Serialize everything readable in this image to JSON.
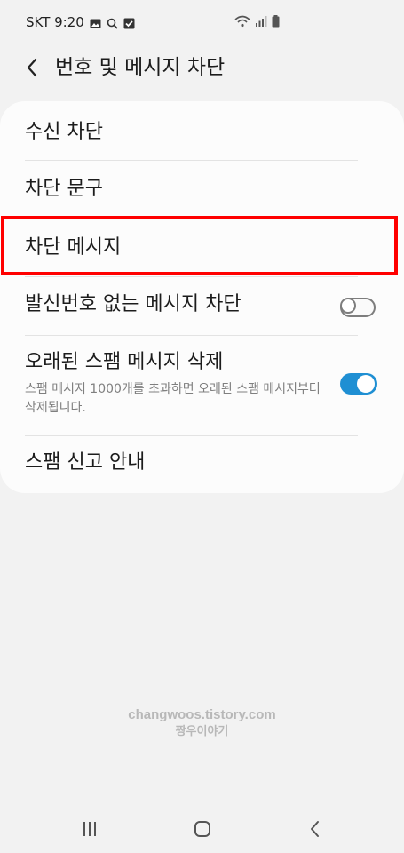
{
  "status_bar": {
    "time": "SKT 9:20",
    "icons": [
      "gallery-icon",
      "search-icon",
      "check-icon",
      "wifi-icon",
      "signal-icon",
      "battery-icon"
    ]
  },
  "header": {
    "title": "번호 및 메시지 차단",
    "back_icon": "chevron-left-icon"
  },
  "settings": {
    "items": [
      {
        "label": "수신 차단"
      },
      {
        "label": "차단 문구"
      },
      {
        "label": "차단 메시지"
      },
      {
        "label": "발신번호 없는 메시지 차단",
        "toggle": false
      },
      {
        "label": "오래된 스팸 메시지 삭제",
        "description": "스팸 메시지 1000개를 초과하면 오래된 스팸 메시지부터 삭제됩니다.",
        "toggle": true
      },
      {
        "label": "스팸 신고 안내"
      }
    ]
  },
  "watermark": {
    "line1": "changwoos.tistory.com",
    "line2": "짱우이야기"
  },
  "navbar": {
    "icons": [
      "recent-apps-icon",
      "home-icon",
      "back-icon"
    ]
  },
  "colors": {
    "background": "#f2f2f2",
    "card": "#fcfcfc",
    "highlight": "#ff0000",
    "toggle_on": "#1f8fd3"
  }
}
